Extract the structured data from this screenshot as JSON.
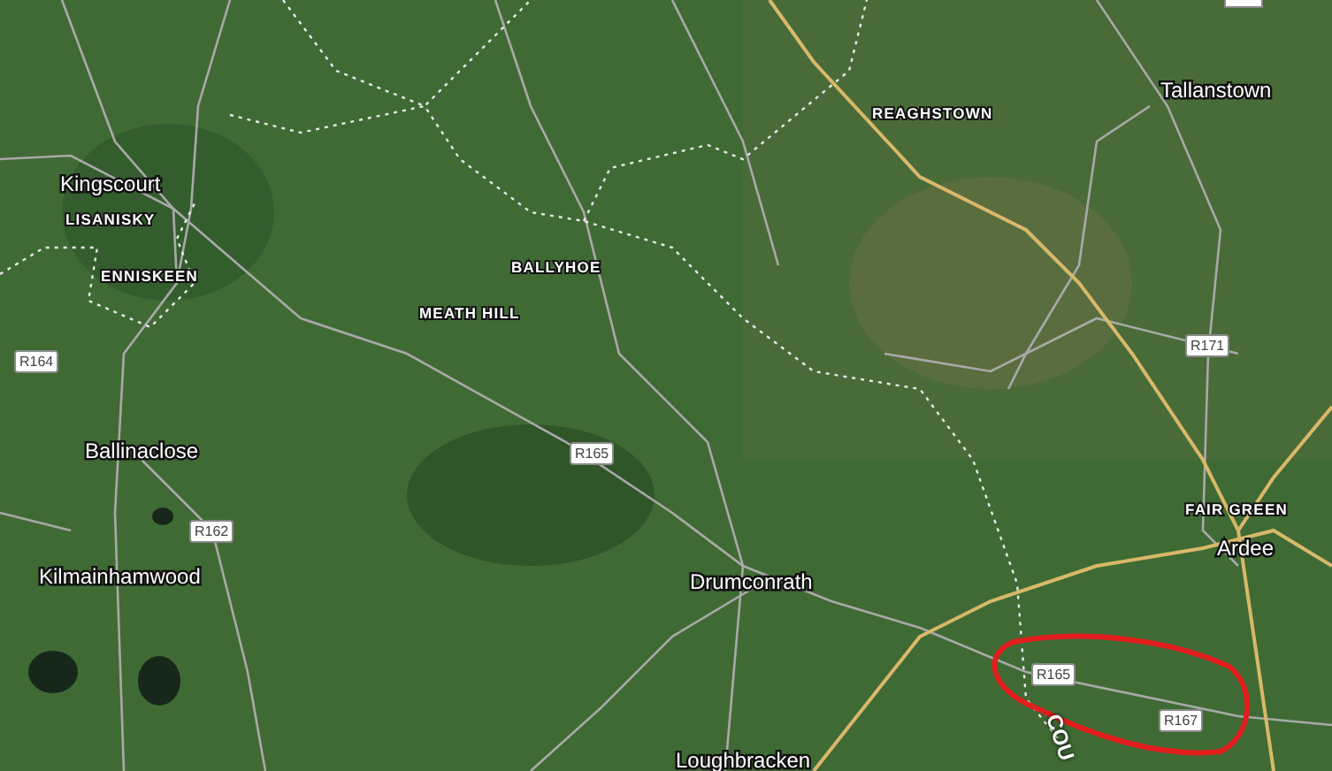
{
  "map": {
    "labels": [
      {
        "text": "Tallanstown",
        "kind": "town"
      },
      {
        "text": "REAGHSTOWN",
        "kind": "locality"
      },
      {
        "text": "Kingscourt",
        "kind": "town"
      },
      {
        "text": "LISANISKY",
        "kind": "locality"
      },
      {
        "text": "BALLYHOE",
        "kind": "locality"
      },
      {
        "text": "ENNISKEEN",
        "kind": "locality"
      },
      {
        "text": "MEATH HILL",
        "kind": "locality"
      },
      {
        "text": "R171",
        "kind": "shield"
      },
      {
        "text": "R164",
        "kind": "shield"
      },
      {
        "text": "Ballinaclose",
        "kind": "town"
      },
      {
        "text": "R165",
        "kind": "shield"
      },
      {
        "text": "FAIR GREEN",
        "kind": "locality"
      },
      {
        "text": "R162",
        "kind": "shield"
      },
      {
        "text": "Ardee",
        "kind": "town"
      },
      {
        "text": "Kilmainhamwood",
        "kind": "town"
      },
      {
        "text": "Drumconrath",
        "kind": "town"
      },
      {
        "text": "R165",
        "kind": "shield"
      },
      {
        "text": "R167",
        "kind": "shield"
      },
      {
        "text": "COU",
        "kind": "county"
      },
      {
        "text": "Loughbracken",
        "kind": "town"
      }
    ]
  }
}
